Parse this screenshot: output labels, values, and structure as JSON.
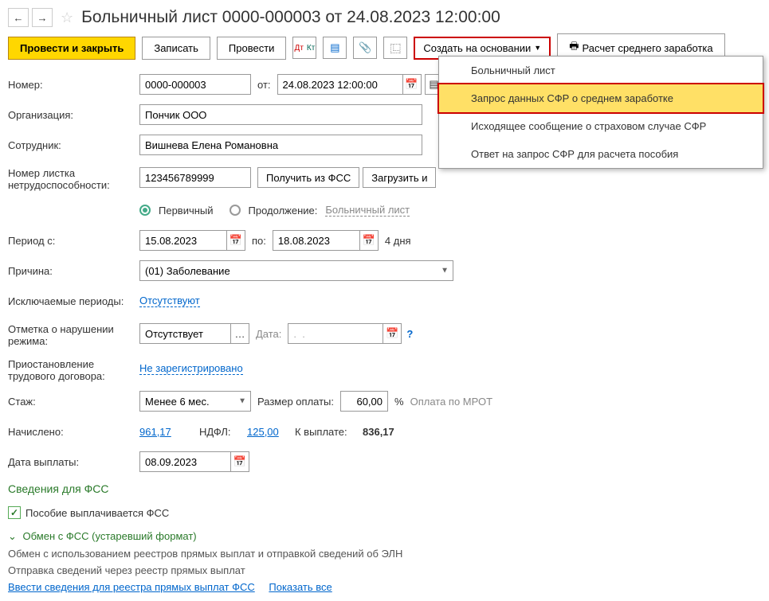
{
  "nav": {
    "back": "←",
    "forward": "→"
  },
  "title": "Больничный лист 0000-000003 от 24.08.2023 12:00:00",
  "toolbar": {
    "submit_close": "Провести и закрыть",
    "save": "Записать",
    "submit": "Провести",
    "create_based": "Создать на основании",
    "calc_avg": "Расчет среднего заработка"
  },
  "dropdown": {
    "items": [
      "Больничный лист",
      "Запрос данных СФР о среднем заработке",
      "Исходящее сообщение о страховом случае СФР",
      "Ответ на запрос СФР для расчета пособия"
    ]
  },
  "fields": {
    "number_label": "Номер:",
    "number": "0000-000003",
    "from_label": "от:",
    "from_date": "24.08.2023 12:00:00",
    "org_label": "Организация:",
    "org": "Пончик ООО",
    "employee_label": "Сотрудник:",
    "employee": "Вишнева Елена Романовна",
    "sheet_num_label": "Номер листка нетрудоспособности:",
    "sheet_num": "123456789999",
    "get_fss": "Получить из ФСС",
    "load_file": "Загрузить и",
    "primary": "Первичный",
    "continuation": "Продолжение:",
    "cont_link": "Больничный лист",
    "period_from_label": "Период с:",
    "period_from": "15.08.2023",
    "to_label": "по:",
    "period_to": "18.08.2023",
    "days": "4 дня",
    "reason_label": "Причина:",
    "reason": "(01) Заболевание",
    "excluded_label": "Исключаемые периоды:",
    "excluded": "Отсутствуют",
    "violation_label": "Отметка о нарушении режима:",
    "violation": "Отсутствует",
    "date_label": "Дата:",
    "date_placeholder": ".  .",
    "suspension_label": "Приостановление трудового договора:",
    "suspension": "Не зарегистрировано",
    "tenure_label": "Стаж:",
    "tenure": "Менее 6 мес.",
    "pay_rate_label": "Размер оплаты:",
    "pay_rate": "60,00",
    "percent": "%",
    "mrot": "Оплата по МРОТ",
    "accrued_label": "Начислено:",
    "accrued": "961,17",
    "ndfl_label": "НДФЛ:",
    "ndfl": "125,00",
    "payout_label": "К выплате:",
    "payout": "836,17",
    "pay_date_label": "Дата выплаты:",
    "pay_date": "08.09.2023"
  },
  "fss": {
    "section_title": "Сведения для ФСС",
    "checkbox": "Пособие выплачивается ФСС",
    "exchange_title": "Обмен с ФСС (устаревший формат)",
    "exchange_desc": "Обмен с использованием реестров прямых выплат и отправкой сведений об ЭЛН",
    "sending": "Отправка сведений через реестр прямых выплат",
    "link1": "Ввести сведения для реестра прямых выплат ФСС",
    "link2": "Показать все"
  }
}
